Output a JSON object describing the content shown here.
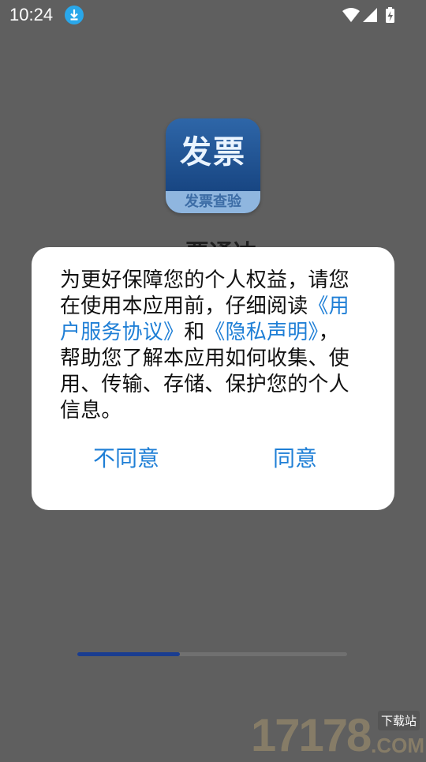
{
  "status_bar": {
    "time": "10:24",
    "download_icon": "download-arrow-icon",
    "wifi_icon": "wifi-icon",
    "signal_icon": "cell-signal-icon",
    "battery_icon": "battery-charging-icon"
  },
  "app": {
    "icon_main_text": "发票",
    "icon_sub_text": "发票查验",
    "name_partial": "票通达"
  },
  "dialog": {
    "intro": "为更好保障您的个人权益，请您在使用本应用前，仔细阅读",
    "link_terms": "《用户服务协议》",
    "connector": "和",
    "link_privacy": "《隐私声明》",
    "rest": "，帮助您了解本应用如何收集、使用、传输、存储、保护您的个人信息。",
    "disagree_label": "不同意",
    "agree_label": "同意"
  },
  "progress": {
    "fraction": 0.38,
    "fill_color": "#1a3d90"
  },
  "watermark": {
    "digits": "17178",
    "site_label": "下载站",
    "com": ".COM"
  }
}
